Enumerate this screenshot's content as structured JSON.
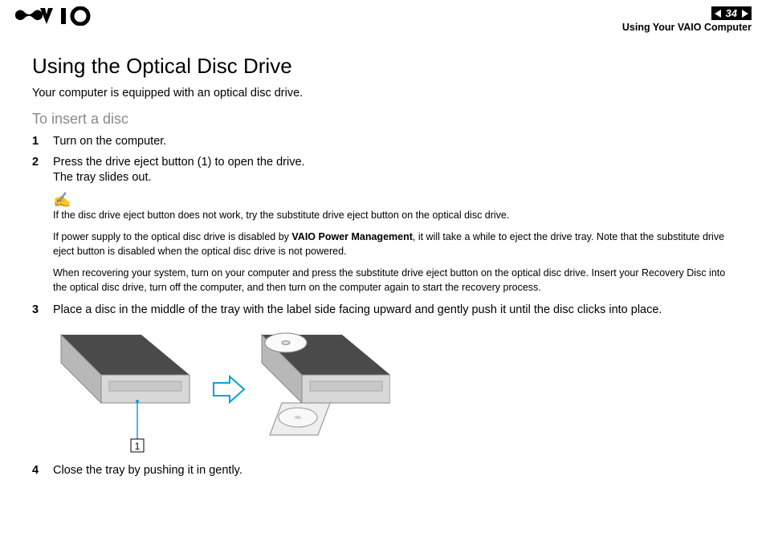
{
  "header": {
    "page_number": "34",
    "section": "Using Your VAIO Computer"
  },
  "title": "Using the Optical Disc Drive",
  "intro": "Your computer is equipped with an optical disc drive.",
  "subheading": "To insert a disc",
  "steps": {
    "s1": {
      "num": "1",
      "text": "Turn on the computer."
    },
    "s2": {
      "num": "2",
      "line1": "Press the drive eject button (1) to open the drive.",
      "line2": "The tray slides out."
    },
    "s3": {
      "num": "3",
      "text": "Place a disc in the middle of the tray with the label side facing upward and gently push it until the disc clicks into place."
    },
    "s4": {
      "num": "4",
      "text": "Close the tray by pushing it in gently."
    }
  },
  "note": {
    "p1": "If the disc drive eject button does not work, try the substitute drive eject button on the optical disc drive.",
    "p2a": "If power supply to the optical disc drive is disabled by ",
    "p2bold": "VAIO Power Management",
    "p2b": ", it will take a while to eject the drive tray. Note that the substitute drive eject button is disabled when the optical disc drive is not powered.",
    "p3": "When recovering your system, turn on your computer and press the substitute drive eject button on the optical disc drive. Insert your Recovery Disc into the optical disc drive, turn off the computer, and then turn on the computer again to start the recovery process."
  },
  "callout_label": "1"
}
